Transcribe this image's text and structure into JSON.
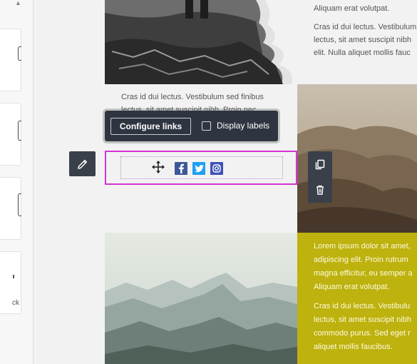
{
  "toolbar": {
    "configure_label": "Configure links",
    "display_labels": "Display labels"
  },
  "sidebar": {
    "partial_label": "ck"
  },
  "blocks": {
    "top_right": {
      "lines": [
        "Aliquam erat volutpat.",
        "Cras id dui lectus. Vestibulum",
        "lectus, sit amet suscipit nibh",
        "elit. Nulla aliquet mollis fauc"
      ]
    },
    "middle_left": {
      "lines": [
        "Cras id dui lectus. Vestibulum sed finibus",
        "lectus, sit amet suscipit nibh. Proin nec"
      ]
    },
    "bottom_right": {
      "lines": [
        "Lorem ipsum dolor sit amet,",
        "adipiscing elit. Proin rutrum",
        "magna efficitur, eu semper a",
        "Aliquam erat volutpat.",
        "Cras id dui lectus. Vestibulu",
        "lectus, sit amet suscipit nibh",
        "commodo purus. Sed eget r",
        "aliquet mollis faucibus."
      ]
    }
  },
  "social": [
    "facebook",
    "twitter",
    "instagram"
  ],
  "colors": {
    "accent_highlight": "#d633d6",
    "toolbar_bg": "#2f3540",
    "mustard_block": "#bdb20e",
    "social_facebook": "#3b5998",
    "social_twitter": "#1da1f2",
    "social_instagram": "#3f51b5"
  }
}
